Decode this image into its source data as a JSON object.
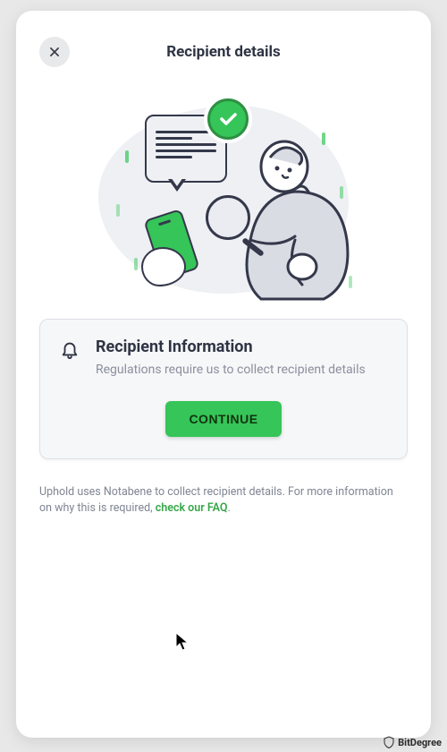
{
  "header": {
    "title": "Recipient details"
  },
  "card": {
    "heading": "Recipient Information",
    "subtext": "Regulations require us to collect recipient details",
    "button_label": "CONTINUE"
  },
  "footer": {
    "text_before": "Uphold uses Notabene to collect recipient details. For more information on why this is required, ",
    "link_text": "check our FAQ",
    "text_after": "."
  },
  "watermark": {
    "label": "BitDegree"
  },
  "colors": {
    "accent": "#35c558",
    "text_primary": "#2e3443",
    "text_muted": "#8a8f9c"
  }
}
